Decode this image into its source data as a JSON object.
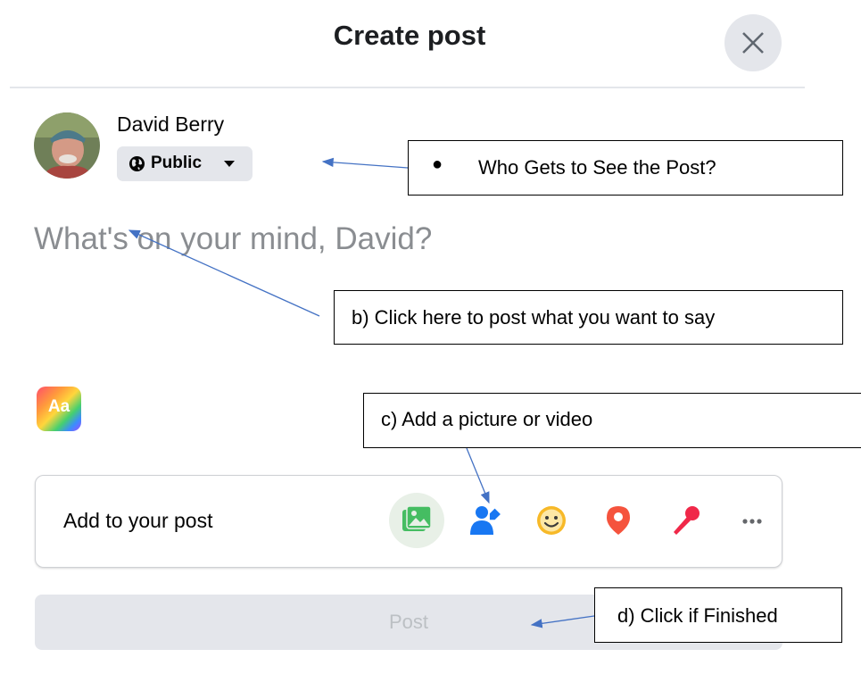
{
  "header": {
    "title": "Create post",
    "close_icon": "close-icon"
  },
  "user": {
    "name": "David Berry",
    "audience": "Public",
    "audience_icon": "globe-icon"
  },
  "composer": {
    "placeholder": "What's on your mind, David?"
  },
  "text_style_button": {
    "label": "Aa"
  },
  "add_to_post": {
    "label": "Add to your post",
    "tools": [
      {
        "name": "photo-video",
        "icon": "photo-icon",
        "color": "#45bd62"
      },
      {
        "name": "tag-people",
        "icon": "tag-people-icon",
        "color": "#1877f2"
      },
      {
        "name": "feeling-activity",
        "icon": "smile-icon",
        "color": "#f7b928"
      },
      {
        "name": "check-in",
        "icon": "location-pin-icon",
        "color": "#f5533d"
      },
      {
        "name": "live-video",
        "icon": "microphone-icon",
        "color": "#f02849"
      },
      {
        "name": "more",
        "icon": "more-icon",
        "color": "#65676b"
      }
    ]
  },
  "post_button": {
    "label": "Post"
  },
  "annotations": {
    "a": {
      "bullet": "●",
      "text": "Who Gets to See the Post?"
    },
    "b": {
      "text": "b) Click here to post what you want to say"
    },
    "c": {
      "text": "c) Add a picture or video"
    },
    "d": {
      "text": "d) Click if Finished"
    },
    "arrow_color": "#4472c4"
  }
}
